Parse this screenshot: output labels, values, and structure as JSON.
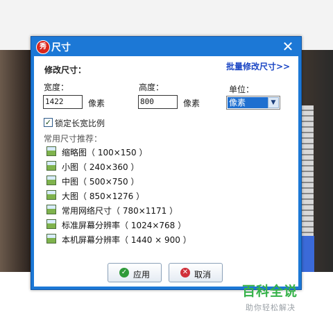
{
  "dialog": {
    "title": "尺寸",
    "app_icon_glyph": "秀",
    "close_glyph": "✕",
    "section_title": "修改尺寸：",
    "batch_link": "批量修改尺寸>>",
    "width_label": "宽度：",
    "width_value": "1422",
    "width_unit": "像素",
    "height_label": "高度：",
    "height_value": "800",
    "height_unit": "像素",
    "unit_label": "单位：",
    "unit_selected": "像素",
    "lock_ratio_checked": true,
    "lock_ratio_label": "锁定长宽比例",
    "presets_title": "常用尺寸推荐：",
    "presets": [
      {
        "label": "缩略图（ 100×150 ）"
      },
      {
        "label": "小图（ 240×360 ）"
      },
      {
        "label": "中图（ 500×750 ）"
      },
      {
        "label": "大图（ 850×1276 ）"
      },
      {
        "label": "常用网络尺寸（ 780×1171 ）"
      },
      {
        "label": "标准屏幕分辨率（ 1024×768 ）"
      },
      {
        "label": "本机屏幕分辨率（ 1440 × 900 ）"
      }
    ],
    "ok_label": "应用",
    "cancel_label": "取消",
    "colors": {
      "titlebar": "#1c78d6",
      "link": "#1a45c4",
      "select_highlight": "#1e6fd0"
    }
  },
  "watermark": {
    "main": "百科全说",
    "sub": "助你轻松解决"
  }
}
